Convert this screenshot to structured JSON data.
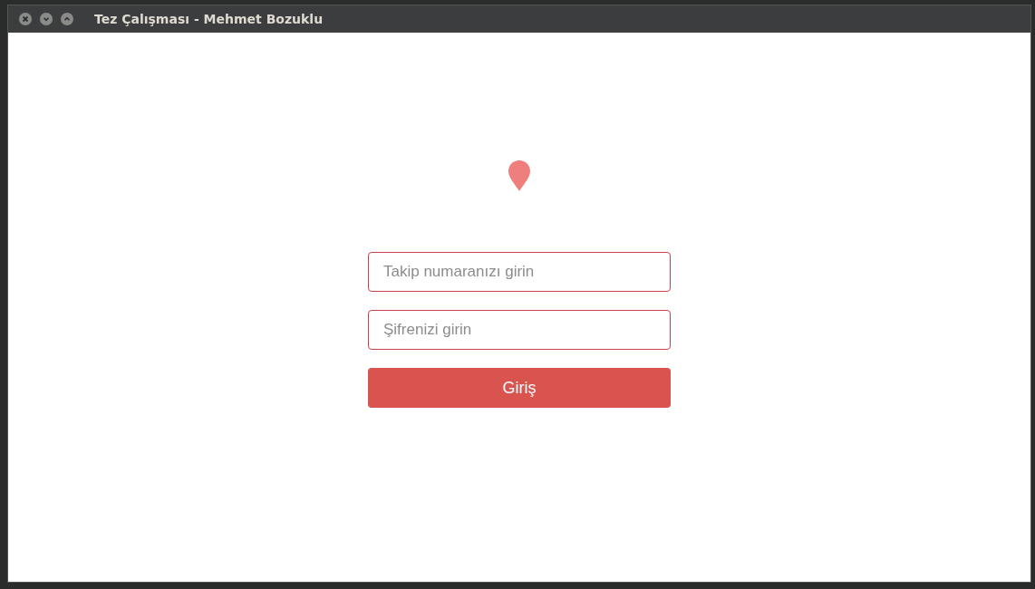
{
  "window": {
    "title": "Tez Çalışması - Mehmet Bozuklu"
  },
  "form": {
    "tracking_field": {
      "placeholder": "Takip numaranızı girin"
    },
    "password_field": {
      "placeholder": "Şifrenizi girin"
    },
    "submit_button": {
      "label": "Giriş"
    }
  }
}
